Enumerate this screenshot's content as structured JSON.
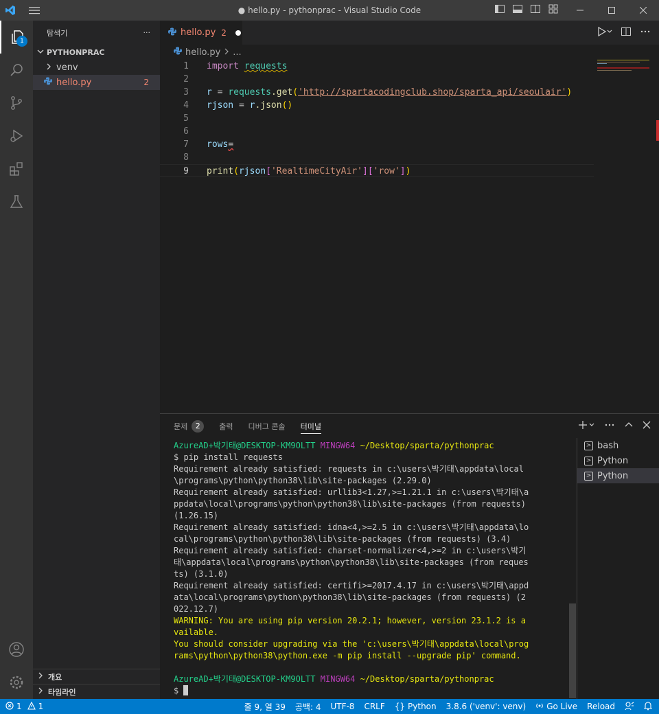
{
  "window": {
    "title": "● hello.py - pythonprac - Visual Studio Code"
  },
  "activity": {
    "explorer_badge": "1"
  },
  "sidebar": {
    "header": "탐색기",
    "more": "···",
    "folder": "PYTHONPRAC",
    "items": [
      {
        "label": "venv",
        "type": "folder"
      },
      {
        "label": "hello.py",
        "type": "file",
        "count": "2"
      }
    ],
    "outline": "개요",
    "timeline": "타임라인"
  },
  "editor": {
    "tab": {
      "name": "hello.py",
      "count": "2"
    },
    "breadcrumb": {
      "file": "hello.py",
      "more": "..."
    },
    "lines": [
      "1",
      "2",
      "3",
      "4",
      "5",
      "6",
      "7",
      "8",
      "9"
    ],
    "code": {
      "l1_kw": "import",
      "l1_mod": "requests",
      "l3_var": "r",
      "l3_eq": " = ",
      "l3_mod": "requests",
      "l3_fn": ".get",
      "l3_str": "'http://spartacodingclub.shop/sparta_api/seoulair'",
      "l4_var": "rjson",
      "l4_eq": " = ",
      "l4_r": "r",
      "l4_fn": ".json",
      "l7_var": "rows",
      "l7_eq": "=",
      "l9_fn": "print",
      "l9_var": "rjson",
      "l9_s1": "'RealtimeCityAir'",
      "l9_s2": "'row'"
    }
  },
  "panel": {
    "tabs": {
      "problems": "문제",
      "problems_count": "2",
      "output": "출력",
      "debug": "디버그 콘솔",
      "terminal": "터미널"
    },
    "terminal_list": [
      "bash",
      "Python",
      "Python"
    ],
    "terminal": {
      "prompt_user": "AzureAD+박기태@DESKTOP-KM9OLTT",
      "prompt_env": "MINGW64",
      "prompt_path": "~/Desktop/sparta/pythonprac",
      "command": "$ pip install requests",
      "out": [
        "Requirement already satisfied: requests in c:\\users\\박기태\\appdata\\local\\programs\\python\\python38\\lib\\site-packages (2.29.0)",
        "Requirement already satisfied: urllib3<1.27,>=1.21.1 in c:\\users\\박기태\\appdata\\local\\programs\\python\\python38\\lib\\site-packages (from requests) (1.26.15)",
        "Requirement already satisfied: idna<4,>=2.5 in c:\\users\\박기태\\appdata\\local\\programs\\python\\python38\\lib\\site-packages (from requests) (3.4)",
        "Requirement already satisfied: charset-normalizer<4,>=2 in c:\\users\\박기태\\appdata\\local\\programs\\python\\python38\\lib\\site-packages (from requests) (3.1.0)",
        "Requirement already satisfied: certifi>=2017.4.17 in c:\\users\\박기태\\appdata\\local\\programs\\python\\python38\\lib\\site-packages (from requests) (2022.12.7)"
      ],
      "warning1": "WARNING: You are using pip version 20.2.1; however, version 23.1.2 is available.",
      "warning2": "You should consider upgrading via the 'c:\\users\\박기태\\appdata\\local\\programs\\python\\python38\\python.exe -m pip install --upgrade pip' command.",
      "prompt2_user": "AzureAD+박기태@DESKTOP-KM9OLTT",
      "prompt2_env": "MINGW64",
      "prompt2_path": "~/Desktop/sparta/pythonprac",
      "dollar": "$"
    }
  },
  "status": {
    "errors": "1",
    "warnings": "1",
    "position": "줄 9, 열 39",
    "spaces": "공백: 4",
    "encoding": "UTF-8",
    "eol": "CRLF",
    "language": "Python",
    "interpreter": "3.8.6 ('venv': venv)",
    "golive": "Go Live",
    "reload": "Reload"
  },
  "colors": {
    "accent": "#007acc",
    "error": "#f48771"
  }
}
